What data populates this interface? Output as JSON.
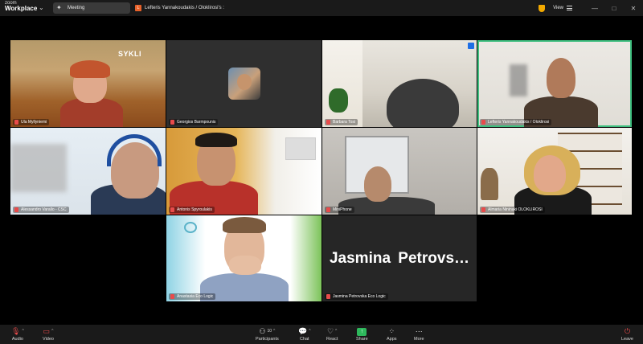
{
  "app": {
    "logo_line1": "zoom",
    "logo_line2": "Workplace",
    "meeting_tab": "Meeting",
    "share_tab": "Lefteris Yannakoudakis / Oloklirosi's :",
    "view_label": "View",
    "window_controls": [
      "—",
      "□",
      "✕"
    ]
  },
  "tiles": [
    {
      "name": "Ula Myllyniemi",
      "muted": true,
      "overlay": "SYKLI"
    },
    {
      "name": "Georgios Barmpounis",
      "muted": true
    },
    {
      "name": "Barbara Tosi",
      "muted": true
    },
    {
      "name": "Lefteris Yannakoudakis / Oloklirosi",
      "muted": true,
      "speaking": true
    },
    {
      "name": "Alessandro Varallo - CSC",
      "muted": true
    },
    {
      "name": "Antonis Spyroulakis",
      "muted": true
    },
    {
      "name": "MiniPhone",
      "muted": true
    },
    {
      "name": "Almaria Nininaki OLOKLIROSI",
      "muted": true
    },
    {
      "name": "Anastasia Eco Logic",
      "muted": true
    },
    {
      "name": "Jasmina Petrovska Eco Logic",
      "muted": true,
      "display_text": "Jasmina  Petrovs…"
    }
  ],
  "toolbar": {
    "audio": "Audio",
    "video": "Video",
    "participants": "Participants",
    "participants_count": "10",
    "chat": "Chat",
    "react": "React",
    "share": "Share",
    "apps": "Apps",
    "more": "More",
    "leave": "Leave"
  },
  "colors": {
    "speaking_border": "#3fbf7f",
    "muted_icon": "#e84b4b",
    "share_button": "#2eb85c",
    "background": "#000000"
  }
}
